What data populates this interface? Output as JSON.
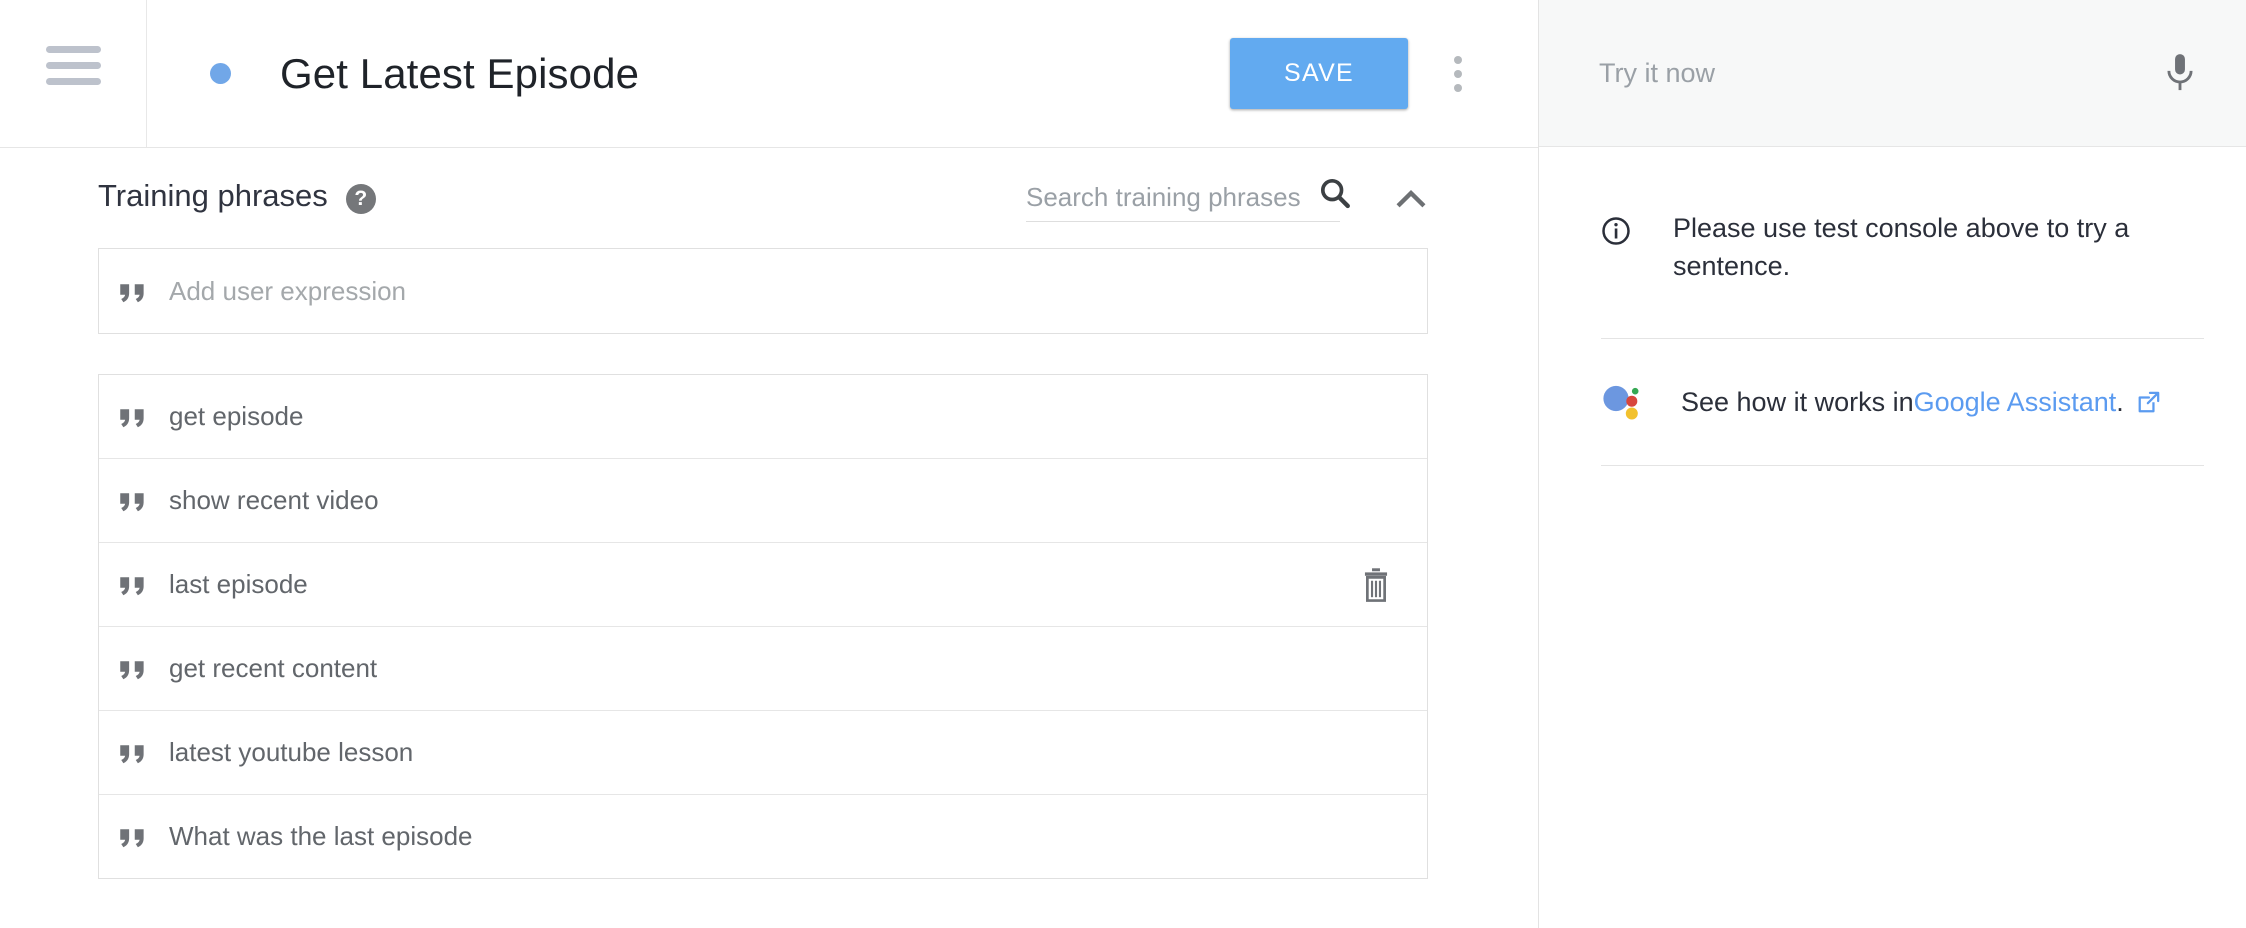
{
  "topbar": {
    "menu_icon": "hamburger-menu-icon",
    "status_dot_color": "#71a7e8",
    "intent_title": "Get Latest Episode",
    "save_label": "SAVE",
    "save_color": "#62aaf0",
    "more_options_icon": "kebab-menu-icon"
  },
  "training": {
    "section_title": "Training phrases",
    "help_icon": "help-circle-icon",
    "help_glyph": "?",
    "search_placeholder": "Search training phrases",
    "search_value": "",
    "search_icon": "search-icon",
    "collapse_icon": "chevron-up-icon",
    "add_placeholder": "Add user expression",
    "add_value": "",
    "quote_icon": "quote-icon",
    "delete_icon": "trash-icon",
    "phrases": [
      {
        "text": "get episode",
        "has_delete": false
      },
      {
        "text": "show recent video",
        "has_delete": false
      },
      {
        "text": "last episode",
        "has_delete": true
      },
      {
        "text": "get recent content",
        "has_delete": false
      },
      {
        "text": "latest youtube lesson",
        "has_delete": false
      },
      {
        "text": "What was the last episode",
        "has_delete": false
      }
    ]
  },
  "test_panel": {
    "try_placeholder": "Try it now",
    "try_value": "",
    "mic_icon": "microphone-icon",
    "info_icon": "info-circle-icon",
    "info_text": "Please use test console above to try a sentence.",
    "assistant_logo": "google-assistant-icon",
    "assistant_prefix": "See how it works in ",
    "assistant_link": "Google Assistant",
    "assistant_suffix": ".",
    "external_link_icon": "external-link-icon",
    "link_color": "#5b9bf0"
  }
}
